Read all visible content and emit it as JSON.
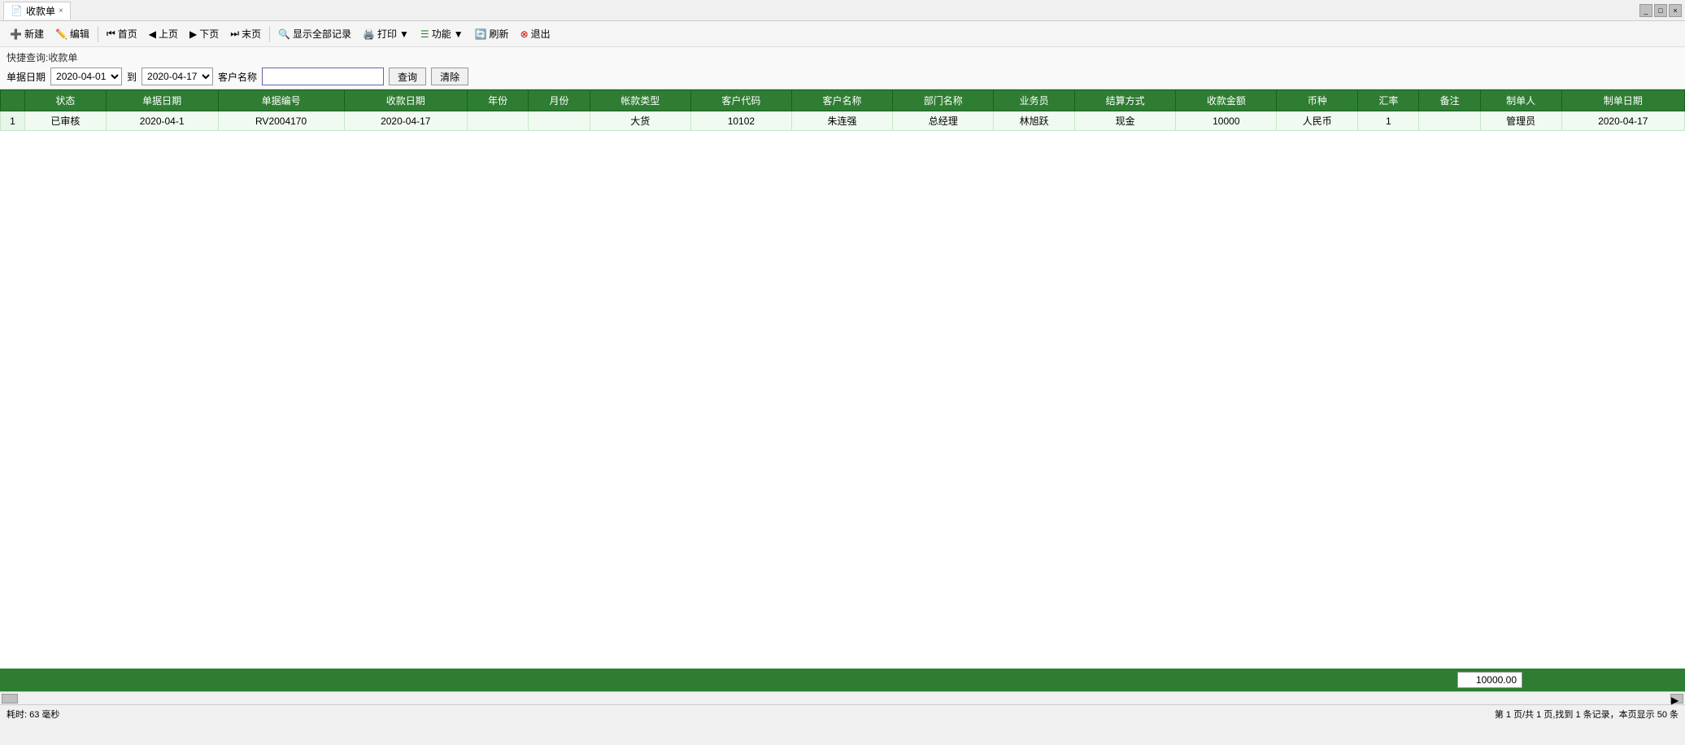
{
  "tab": {
    "title": "收款单",
    "close_icon": "×"
  },
  "toolbar": {
    "new_label": "新建",
    "edit_label": "编辑",
    "first_label": "首页",
    "prev_label": "上页",
    "next_label": "下页",
    "last_label": "末页",
    "show_all_label": "显示全部记录",
    "print_label": "打印",
    "function_label": "功能",
    "refresh_label": "刷新",
    "exit_label": "退出"
  },
  "quick_search": {
    "title": "快捷查询:收款单",
    "date_label": "单据日期",
    "date_from": "2020-04-01",
    "date_to": "2020-04-17",
    "customer_label": "客户名称",
    "customer_value": "",
    "query_btn": "查询",
    "clear_btn": "清除"
  },
  "table": {
    "columns": [
      "",
      "状态",
      "单据日期",
      "单据编号",
      "收款日期",
      "年份",
      "月份",
      "帐款类型",
      "客户代码",
      "客户名称",
      "部门名称",
      "业务员",
      "结算方式",
      "收款金额",
      "币种",
      "汇率",
      "备注",
      "制单人",
      "制单日期"
    ],
    "rows": [
      {
        "num": "1",
        "status": "已审核",
        "doc_date": "2020-04-1",
        "doc_no": "RV2004170",
        "receipt_date": "2020-04-17",
        "year": "",
        "month": "",
        "account_type": "大货",
        "customer_code": "10102",
        "customer_name": "朱连强",
        "dept": "总经理",
        "salesman": "林旭跃",
        "settlement": "现金",
        "amount": "10000",
        "currency": "人民币",
        "rate": "1",
        "remark": "",
        "creator": "管理员",
        "create_date": "2020-04-17"
      }
    ],
    "summary_amount": "10000.00"
  },
  "status_bar": {
    "elapsed": "耗时: 63 毫秒",
    "page_info": "第 1 页/共 1 页,找到 1 条记录，本页显示 50 条"
  }
}
